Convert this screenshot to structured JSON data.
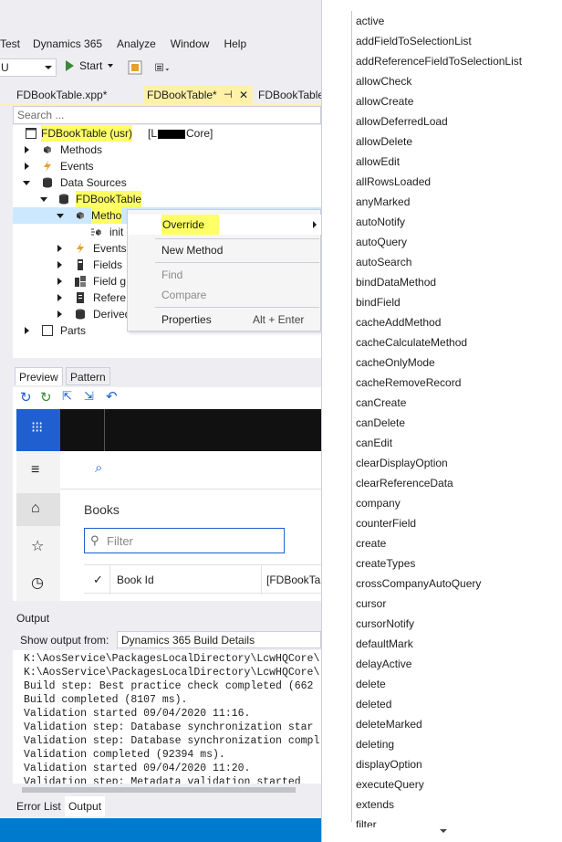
{
  "menu": [
    "Test",
    "Dynamics 365",
    "Analyze",
    "Window",
    "Help"
  ],
  "toolbar": {
    "combo_value": "U",
    "start_label": "Start"
  },
  "tabs": [
    {
      "label": "FDBookTable.xpp*",
      "active": false
    },
    {
      "label": "FDBookTable*",
      "active": true
    },
    {
      "label": "FDBookTable",
      "active": false
    }
  ],
  "search_placeholder": "Search ...",
  "tree": {
    "root": "FDBookTable (usr)",
    "root_suffix": "[L",
    "root_suffix2": "Core]",
    "methods": "Methods",
    "events": "Events",
    "data_sources": "Data Sources",
    "ds_table": "FDBookTable",
    "ds_methods": "Metho",
    "init": "init",
    "ds_events": "Events",
    "fields": "Fields",
    "field_groups": "Field g",
    "references": "Refere",
    "derived": "Derived",
    "parts": "Parts"
  },
  "context_menu": {
    "override": "Override",
    "new_method": "New Method",
    "find": "Find",
    "compare": "Compare",
    "properties": "Properties",
    "properties_shortcut": "Alt + Enter"
  },
  "preview": {
    "tab_preview": "Preview",
    "tab_pattern": "Pattern",
    "page_title": "Books",
    "filter_placeholder": "Filter",
    "col_book_id": "Book Id",
    "col_other": "[FDBookTa"
  },
  "output": {
    "title": "Output",
    "show_from_label": "Show output from:",
    "show_from_value": "Dynamics 365 Build Details",
    "lines": [
      "K:\\AosService\\PackagesLocalDirectory\\LcwHQCore\\",
      "K:\\AosService\\PackagesLocalDirectory\\LcwHQCore\\",
      "Build step: Best practice check completed (662",
      "Build completed (8107 ms).",
      "Validation started 09/04/2020 11:16.",
      "Validation step: Database synchronization star",
      "Validation step: Database synchronization compl",
      "Validation completed (92394 ms).",
      "Validation started 09/04/2020 11:20.",
      "Validation step: Metadata validation started"
    ],
    "tab_error_list": "Error List",
    "tab_output": "Output"
  },
  "method_list": [
    "active",
    "addFieldToSelectionList",
    "addReferenceFieldToSelectionList",
    "allowCheck",
    "allowCreate",
    "allowDeferredLoad",
    "allowDelete",
    "allowEdit",
    "allRowsLoaded",
    "anyMarked",
    "autoNotify",
    "autoQuery",
    "autoSearch",
    "bindDataMethod",
    "bindField",
    "cacheAddMethod",
    "cacheCalculateMethod",
    "cacheOnlyMode",
    "cacheRemoveRecord",
    "canCreate",
    "canDelete",
    "canEdit",
    "clearDisplayOption",
    "clearReferenceData",
    "company",
    "counterField",
    "create",
    "createTypes",
    "crossCompanyAutoQuery",
    "cursor",
    "cursorNotify",
    "defaultMark",
    "delayActive",
    "delete",
    "deleted",
    "deleteMarked",
    "deleting",
    "displayOption",
    "executeQuery",
    "extends",
    "filter"
  ],
  "colors": {
    "accent_blue": "#007acc",
    "highlight": "#ffff66",
    "d365_blue": "#1f5fcf"
  }
}
